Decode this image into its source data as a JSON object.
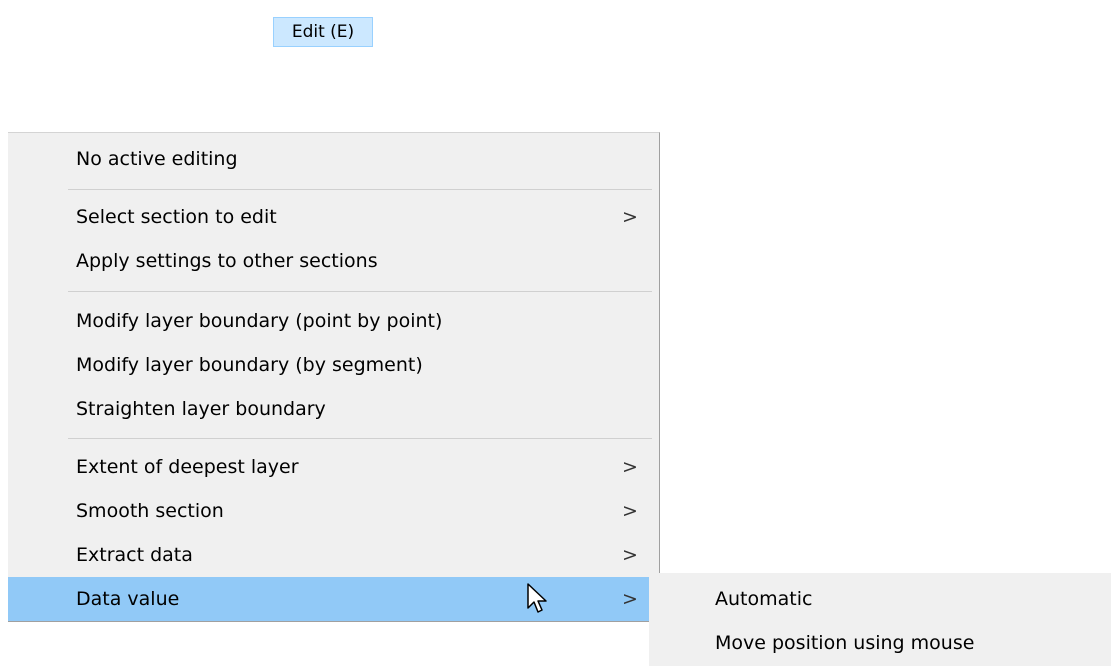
{
  "menubar": {
    "edit_label": "Edit (E)"
  },
  "menu": {
    "items": [
      {
        "label": "No active editing"
      },
      {
        "label": "Select section to edit",
        "submenu_arrow": ">"
      },
      {
        "label": "Apply settings to other sections"
      },
      {
        "label": "Modify layer boundary (point by point)"
      },
      {
        "label": "Modify layer boundary (by segment)"
      },
      {
        "label": "Straighten layer boundary"
      },
      {
        "label": "Extent of deepest layer",
        "submenu_arrow": ">"
      },
      {
        "label": "Smooth section",
        "submenu_arrow": ">"
      },
      {
        "label": "Extract data",
        "submenu_arrow": ">"
      },
      {
        "label": "Data value",
        "submenu_arrow": ">",
        "highlighted": true
      }
    ]
  },
  "submenu": {
    "items": [
      {
        "label": "Automatic"
      },
      {
        "label": "Move position using mouse"
      }
    ]
  },
  "colors": {
    "menu_background": "#f0f0f0",
    "highlight": "#91c9f7",
    "menubar_highlight": "#cce8ff"
  },
  "icons": {
    "cursor": "mouse-pointer-icon",
    "submenu_arrow": "chevron-right-icon"
  }
}
